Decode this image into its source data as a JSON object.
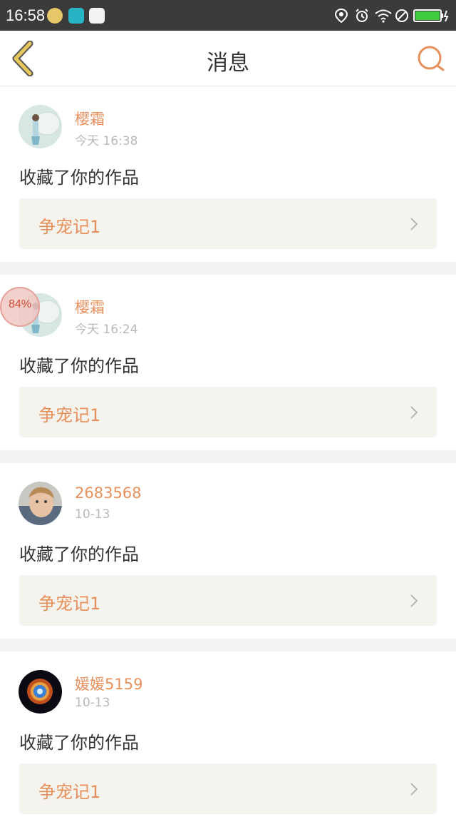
{
  "status_bar": {
    "time": "16:58",
    "icons": [
      "app-icon-1",
      "app-icon-2",
      "app-icon-3",
      "location-icon",
      "alarm-icon",
      "wifi-icon",
      "dnd-icon",
      "battery-icon"
    ]
  },
  "header": {
    "title": "消息",
    "back_icon": "chevron-left-icon",
    "search_icon": "search-icon"
  },
  "floating_badge": {
    "label": "84%"
  },
  "messages": [
    {
      "username": "樱霜",
      "time": "今天 16:38",
      "action": "收藏了你的作品",
      "work": "争宠记1"
    },
    {
      "username": "樱霜",
      "time": "今天 16:24",
      "action": "收藏了你的作品",
      "work": "争宠记1"
    },
    {
      "username": "2683568",
      "time": "10-13",
      "action": "收藏了你的作品",
      "work": "争宠记1"
    },
    {
      "username": "媛媛5159",
      "time": "10-13",
      "action": "收藏了你的作品",
      "work": "争宠记1"
    }
  ],
  "colors": {
    "accent": "#e8905c",
    "back_icon": "#e6c85a",
    "status_bar": "#3b3b3b",
    "link_bg": "#f4f3ee"
  }
}
